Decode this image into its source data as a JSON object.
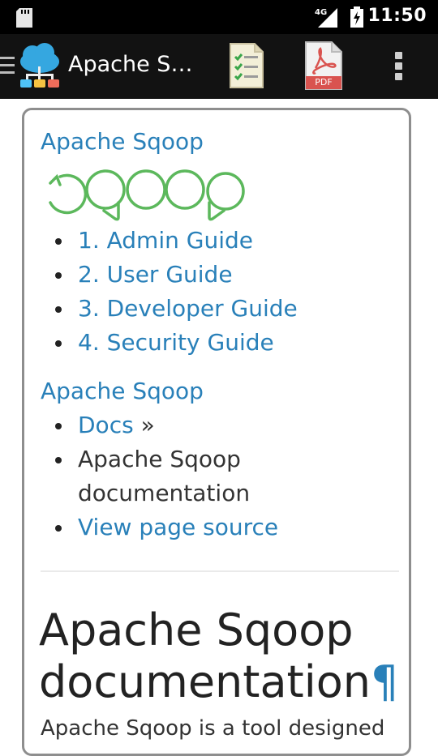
{
  "status_bar": {
    "network": "4G",
    "time": "11:50"
  },
  "action_bar": {
    "title": "Apache Sqoop",
    "pdf_label": "PDF"
  },
  "content": {
    "site_name": "Apache Sqoop",
    "logo_text": "sqoop",
    "toc": [
      {
        "label": "1. Admin Guide"
      },
      {
        "label": "2. User Guide"
      },
      {
        "label": "3. Developer Guide"
      },
      {
        "label": "4. Security Guide"
      }
    ],
    "breadcrumb_title": "Apache Sqoop",
    "breadcrumbs": {
      "docs": "Docs",
      "separator": "»",
      "current": "Apache Sqoop documentation",
      "view_source": "View page source"
    },
    "heading": "Apache Sqoop documentation",
    "pilcrow": "¶",
    "intro_fragment": "Apache Sqoop is a tool designed"
  },
  "colors": {
    "link": "#2980b9",
    "logo_green": "#5cb85c",
    "status_bar_bg": "#000000",
    "action_bar_bg": "#121212",
    "pdf_red": "#d9534f"
  }
}
